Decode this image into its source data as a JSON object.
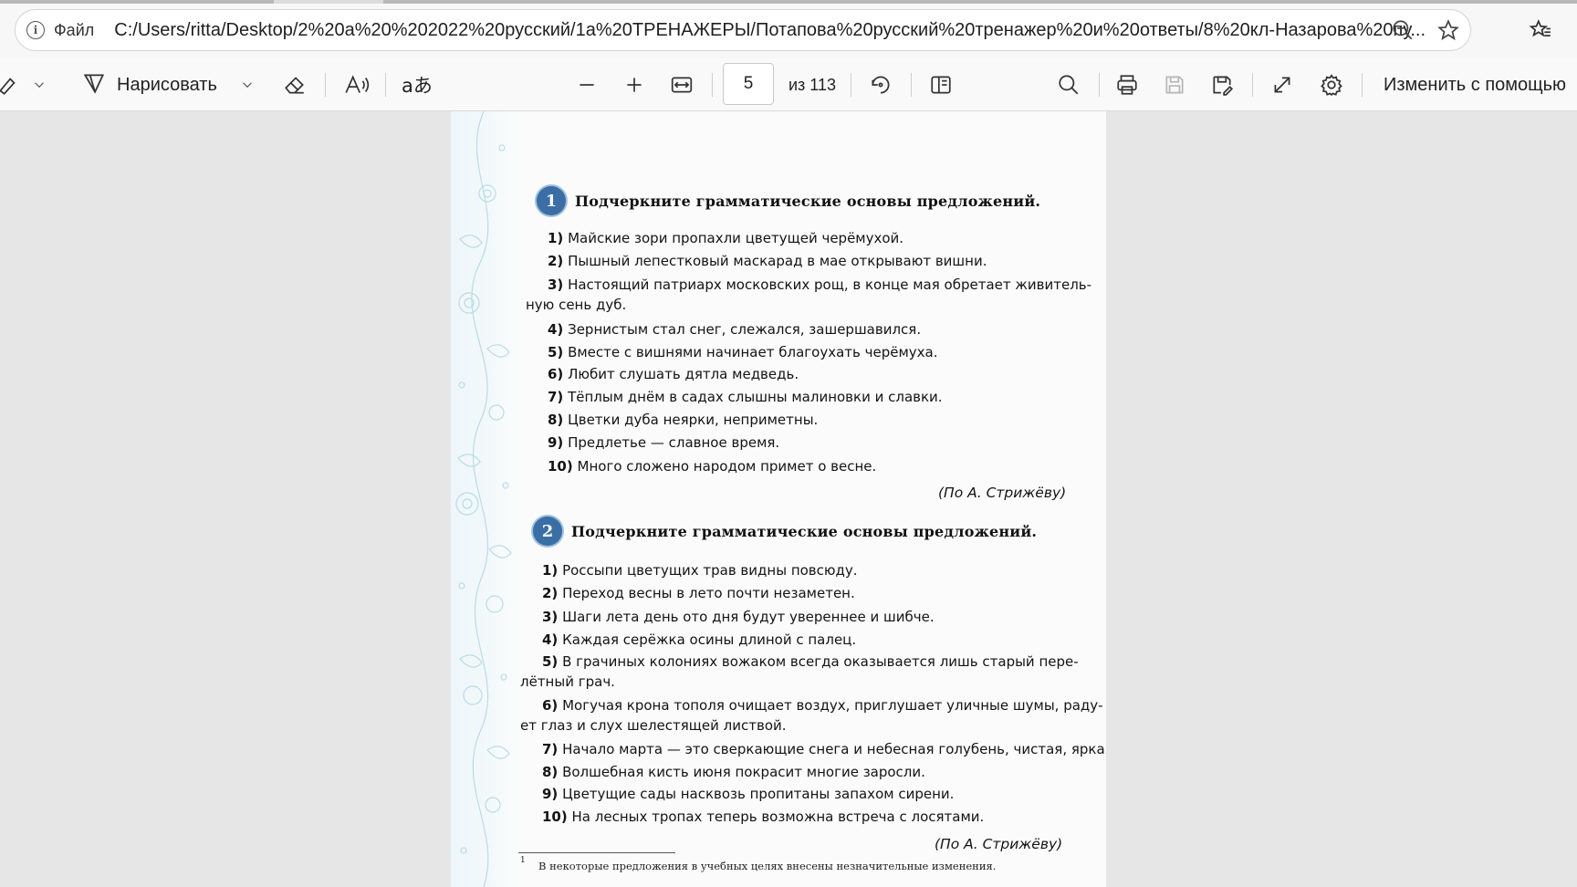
{
  "address_bar": {
    "file_label": "Файл",
    "url": "C:/Users/ritta/Desktop/2%20а%20%202022%20русский/1а%20ТРЕНАЖЕРЫ/Потапова%20русский%20тренажер%20и%20ответы/8%20кл-Назарова%20пу..."
  },
  "toolbar": {
    "draw_label": "Нарисовать",
    "current_page": "5",
    "page_total": "из 113",
    "edit_with_label": "Изменить с помощью"
  },
  "document": {
    "exercise1": {
      "number": "1",
      "title": "Подчеркните грамматические основы предложений.",
      "lines": [
        {
          "n": "1)",
          "t": "Майские зори пропахли цветущей черёмухой."
        },
        {
          "n": "2)",
          "t": "Пышный лепестковый маскарад в мае открывают вишни."
        },
        {
          "n": "3)",
          "t": "Настоящий патриарх московских рощ, в конце мая обретает живитель-"
        },
        {
          "n": "",
          "t": "ную сень дуб."
        },
        {
          "n": "4)",
          "t": "Зернистым стал снег, слежался, зашершавился."
        },
        {
          "n": "5)",
          "t": "Вместе с вишнями начинает благоухать черёмуха."
        },
        {
          "n": "6)",
          "t": "Любит слушать дятла медведь."
        },
        {
          "n": "7)",
          "t": "Тёплым днём в садах слышны малиновки и славки."
        },
        {
          "n": "8)",
          "t": "Цветки дуба неярки, неприметны."
        },
        {
          "n": "9)",
          "t": "Предлетье — славное время."
        },
        {
          "n": "10)",
          "t": "Много сложено народом примет о весне."
        }
      ],
      "author": "(По А. Стрижёву)"
    },
    "exercise2": {
      "number": "2",
      "title": "Подчеркните грамматические основы предложений.",
      "lines": [
        {
          "n": "1)",
          "t": "Россыпи цветущих трав видны повсюду."
        },
        {
          "n": "2)",
          "t": "Переход весны в лето почти незаметен."
        },
        {
          "n": "3)",
          "t": "Шаги лета день ото дня будут увереннее и шибче."
        },
        {
          "n": "4)",
          "t": "Каждая серёжка осины длиной с палец."
        },
        {
          "n": "5)",
          "t": "В грачиных колониях вожаком всегда оказывается лишь старый пере-"
        },
        {
          "n": "",
          "t": "лётный грач."
        },
        {
          "n": "6)",
          "t": "Могучая крона тополя очищает воздух, приглушает уличные шумы, раду-"
        },
        {
          "n": "",
          "t": "ет глаз и слух шелестящей листвой."
        },
        {
          "n": "7)",
          "t": "Начало марта — это сверкающие снега и небесная голубень, чистая, яркая!"
        },
        {
          "n": "8)",
          "t": "Волшебная кисть июня покрасит многие заросли."
        },
        {
          "n": "9)",
          "t": "Цветущие сады насквозь пропитаны запахом сирени."
        },
        {
          "n": "10)",
          "t": "На лесных тропах теперь возможна встреча с лосятами."
        }
      ],
      "author": "(По А. Стрижёву)"
    },
    "footnote_mark": "1",
    "footnote": "В некоторые предложения в учебных целях внесены незначительные изменения."
  },
  "icons": {
    "info": "info-icon",
    "zoom": "zoom-out-icon",
    "favorite": "star-icon",
    "favorites_bar": "favorites-icon",
    "highlight": "highlight-icon",
    "draw": "draw-icon",
    "erase": "eraser-icon",
    "read_aloud": "read-aloud-icon",
    "translate": "translate-icon",
    "minus": "zoom-minus-icon",
    "plus": "zoom-plus-icon",
    "fit": "fit-width-icon",
    "rotate": "rotate-icon",
    "layout": "page-view-icon",
    "search": "search-icon",
    "print": "print-icon",
    "save": "save-icon",
    "save_as": "save-as-icon",
    "fullscreen": "fullscreen-icon",
    "settings": "gear-icon"
  },
  "colors": {
    "badge": "#3a6ea5",
    "page_bg": "#fbfbfb",
    "viewer_bg": "#e6e6e6"
  }
}
